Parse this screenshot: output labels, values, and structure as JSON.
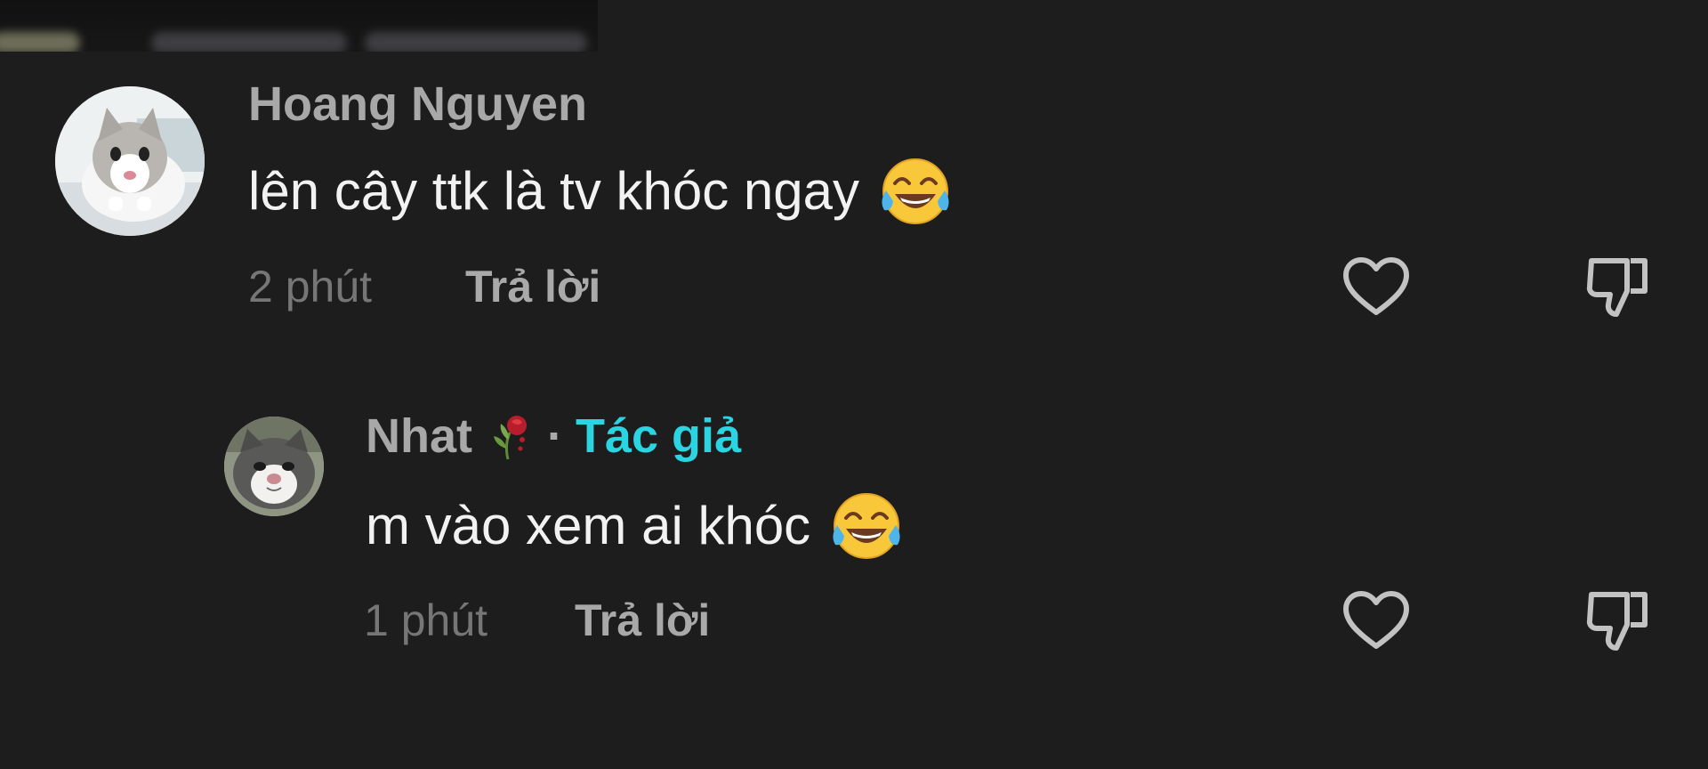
{
  "comments": [
    {
      "username": "Hoang Nguyen",
      "text": "lên cây ttk là tv khóc ngay",
      "emoji": "face-with-tears-of-joy",
      "time": "2 phút",
      "reply_label": "Trả lời"
    }
  ],
  "replies": [
    {
      "username": "Nhat",
      "name_emoji": "wilted-rose",
      "separator": "·",
      "author_badge": "Tác giả",
      "text": "m vào xem ai khóc",
      "emoji": "face-with-tears-of-joy",
      "time": "1 phút",
      "reply_label": "Trả lời"
    }
  ],
  "colors": {
    "background": "#1d1d1d",
    "username": "#a8a8a8",
    "comment_text": "#f2f2f2",
    "time": "#767676",
    "reply": "#a9a9a9",
    "author_badge": "#2ad4e0",
    "icon_stroke": "#c2c2c2"
  },
  "icons": [
    "heart-outline-icon",
    "thumbs-down-outline-icon"
  ]
}
